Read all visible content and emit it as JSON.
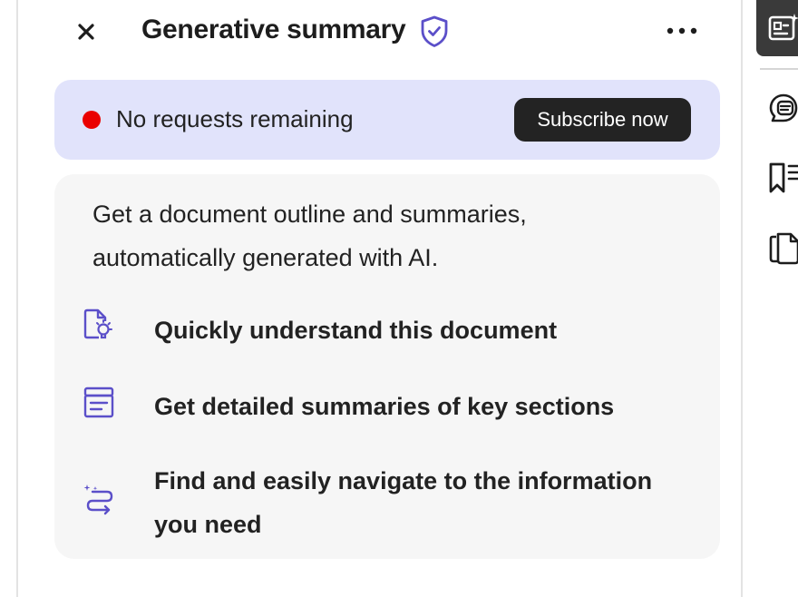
{
  "panel": {
    "title": "Generative summary",
    "close_icon": "close-icon",
    "shield_icon": "shield-check-icon",
    "more_icon": "more-horizontal-icon"
  },
  "alert": {
    "text": "No requests remaining",
    "button_label": "Subscribe now",
    "status_color": "#ea0000",
    "background": "#e1e3fb"
  },
  "card": {
    "intro": "Get a document outline and summaries, automatically generated with AI.",
    "features": [
      {
        "icon": "document-lightbulb-icon",
        "text": "Quickly understand this document"
      },
      {
        "icon": "sections-list-icon",
        "text": "Get detailed summaries of key sections"
      },
      {
        "icon": "navigate-arrows-icon",
        "text": "Find and easily navigate to the information you need"
      }
    ]
  },
  "right_rail": {
    "items": [
      {
        "icon": "generative-summary-icon",
        "active": true
      },
      {
        "icon": "ai-assistant-icon",
        "active": false
      },
      {
        "icon": "bookmarks-icon",
        "active": false
      },
      {
        "icon": "pages-icon",
        "active": false
      }
    ]
  },
  "colors": {
    "accent_purple": "#5b4fc9",
    "dark_button": "#232323"
  }
}
